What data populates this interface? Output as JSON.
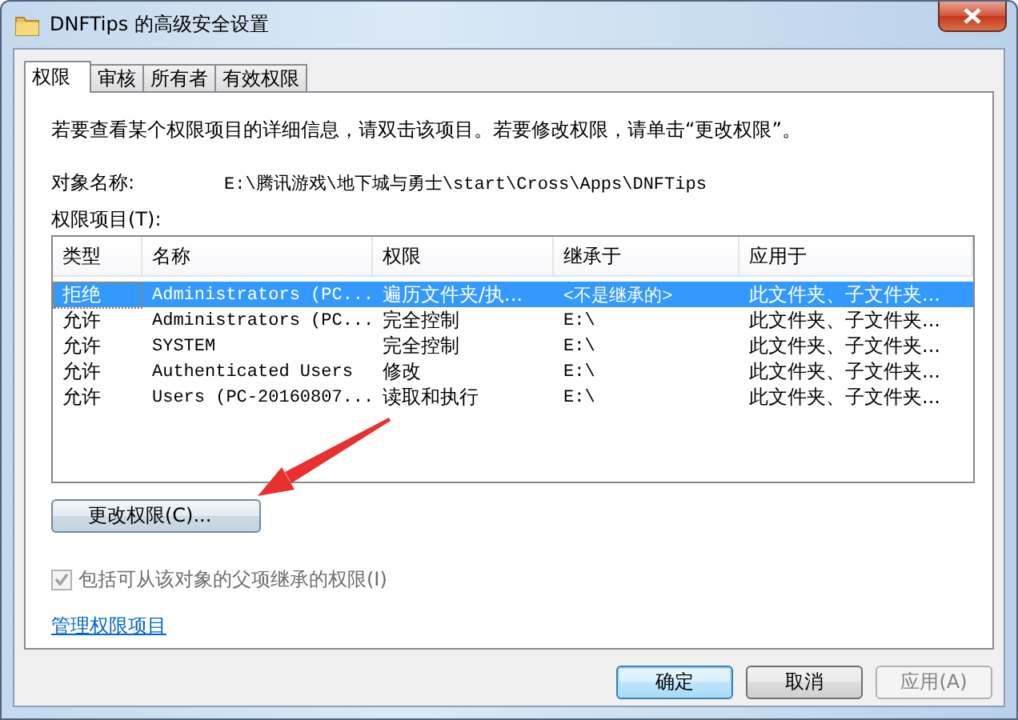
{
  "window": {
    "title": "DNFTips 的高级安全设置"
  },
  "tabs": [
    {
      "label": "权限",
      "selected": true
    },
    {
      "label": "审核",
      "selected": false
    },
    {
      "label": "所有者",
      "selected": false
    },
    {
      "label": "有效权限",
      "selected": false
    }
  ],
  "description": "若要查看某个权限项目的详细信息，请双击该项目。若要修改权限，请单击“更改权限”。",
  "object_name": {
    "label": "对象名称:",
    "value": "E:\\腾讯游戏\\地下城与勇士\\start\\Cross\\Apps\\DNFTips"
  },
  "entries_label": "权限项目(T):",
  "table": {
    "columns": [
      "类型",
      "名称",
      "权限",
      "继承于",
      "应用于"
    ],
    "rows": [
      {
        "type": "拒绝",
        "name": "Administrators (PC...",
        "permission": "遍历文件夹/执...",
        "inherited_from": "<不是继承的>",
        "applies_to": "此文件夹、子文件夹...",
        "selected": true
      },
      {
        "type": "允许",
        "name": "Administrators (PC...",
        "permission": "完全控制",
        "inherited_from": "E:\\",
        "applies_to": "此文件夹、子文件夹...",
        "selected": false
      },
      {
        "type": "允许",
        "name": "SYSTEM",
        "permission": "完全控制",
        "inherited_from": "E:\\",
        "applies_to": "此文件夹、子文件夹...",
        "selected": false
      },
      {
        "type": "允许",
        "name": "Authenticated Users",
        "permission": "修改",
        "inherited_from": "E:\\",
        "applies_to": "此文件夹、子文件夹...",
        "selected": false
      },
      {
        "type": "允许",
        "name": "Users (PC-20160807...",
        "permission": "读取和执行",
        "inherited_from": "E:\\",
        "applies_to": "此文件夹、子文件夹...",
        "selected": false
      }
    ]
  },
  "change_button": {
    "label": "更改权限(C)..."
  },
  "inherit_checkbox": {
    "label": "包括可从该对象的父项继承的权限(I)",
    "checked": true,
    "disabled": true
  },
  "manage_link": "管理权限项目",
  "buttons": [
    {
      "label": "确定",
      "default": true,
      "disabled": false
    },
    {
      "label": "取消",
      "default": false,
      "disabled": false
    },
    {
      "label": "应用(A)",
      "default": false,
      "disabled": true
    }
  ]
}
